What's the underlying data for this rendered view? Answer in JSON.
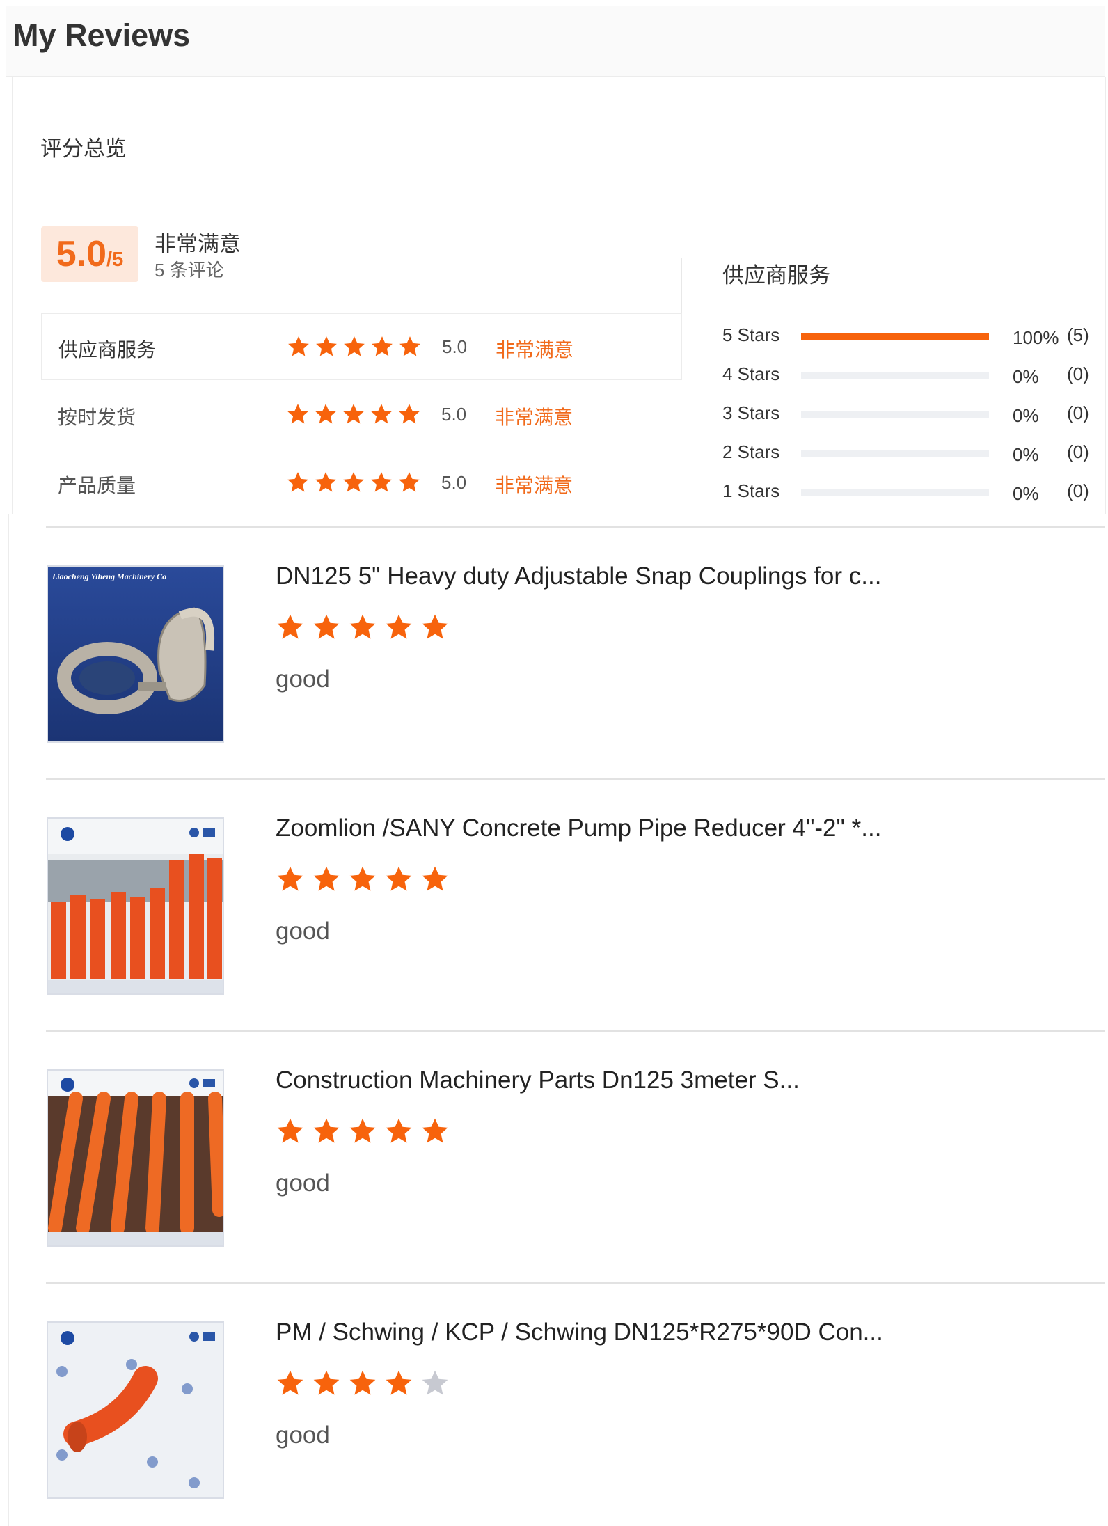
{
  "page": {
    "title": "My Reviews"
  },
  "overview": {
    "title": "评分总览",
    "score": "5.0",
    "score_max": "/5",
    "label": "非常满意",
    "count_text": "5 条评论",
    "dimensions": [
      {
        "label": "供应商服务",
        "stars": 5,
        "value": "5.0",
        "desc": "非常满意"
      },
      {
        "label": "按时发货",
        "stars": 5,
        "value": "5.0",
        "desc": "非常满意"
      },
      {
        "label": "产品质量",
        "stars": 5,
        "value": "5.0",
        "desc": "非常满意"
      }
    ]
  },
  "distribution": {
    "title": "供应商服务",
    "rows": [
      {
        "label": "5  Stars",
        "fraction": 1.0,
        "pct": "100%",
        "count": "(5)"
      },
      {
        "label": "4  Stars",
        "fraction": 0.0,
        "pct": "0%",
        "count": "(0)"
      },
      {
        "label": "3  Stars",
        "fraction": 0.0,
        "pct": "0%",
        "count": "(0)"
      },
      {
        "label": "2  Stars",
        "fraction": 0.0,
        "pct": "0%",
        "count": "(0)"
      },
      {
        "label": "1  Stars",
        "fraction": 0.0,
        "pct": "0%",
        "count": "(0)"
      }
    ]
  },
  "colors": {
    "accent": "#f7630c",
    "accent_text": "#f16a1b",
    "badge_bg": "#fde8dc",
    "star_off": "#c7c9d1"
  },
  "reviews": [
    {
      "title": "DN125 5\" Heavy duty Adjustable Snap Couplings for c...",
      "stars": 5,
      "text": "good",
      "image": "snap-coupling-photo",
      "image_caption": "Liaocheng Yiheng Machinery Co"
    },
    {
      "title": "Zoomlion /SANY Concrete Pump Pipe Reducer 4\"-2\" *...",
      "stars": 5,
      "text": "good",
      "image": "orange-reducer-pipes-photo"
    },
    {
      "title": "Construction Machinery Parts Dn125 3meter S...",
      "stars": 5,
      "text": "good",
      "image": "orange-pipes-photo"
    },
    {
      "title": "PM / Schwing / KCP / Schwing DN125*R275*90D Con...",
      "stars": 4,
      "text": "good",
      "image": "orange-elbow-photo"
    }
  ]
}
